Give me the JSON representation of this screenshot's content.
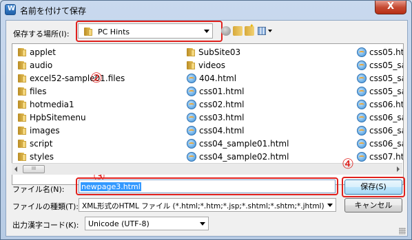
{
  "window": {
    "title": "名前を付けて保存",
    "close_label": "X"
  },
  "location": {
    "label": "保存する場所(I):",
    "value": "PC Hints"
  },
  "files": {
    "col1": [
      "applet",
      "audio",
      "excel52-sample01.files",
      "files",
      "hotmedia1",
      "HpbSitemenu",
      "images",
      "script",
      "styles"
    ],
    "col2": [
      {
        "name": "SubSite03",
        "type": "folder"
      },
      {
        "name": "videos",
        "type": "folder"
      },
      {
        "name": "404.html",
        "type": "html"
      },
      {
        "name": "css01.html",
        "type": "html"
      },
      {
        "name": "css02.html",
        "type": "html"
      },
      {
        "name": "css03.html",
        "type": "html"
      },
      {
        "name": "css04.html",
        "type": "html"
      },
      {
        "name": "css04_sample01.html",
        "type": "html"
      },
      {
        "name": "css04_sample02.html",
        "type": "html"
      }
    ],
    "col3": [
      "css05.ht",
      "css05_sa",
      "css05_sa",
      "css05_sa",
      "css06.ht",
      "css06_sa",
      "css06_sa",
      "css06_sa",
      "css07.ht"
    ],
    "scroll_thumb_label": "III"
  },
  "filename": {
    "label": "ファイル名(N):",
    "value": "newpage3.html"
  },
  "filetype": {
    "label": "ファイルの種類(T):",
    "value": "XML形式のHTML ファイル (*.html;*.htm;*.jsp;*.shtml;*.shtm;*.jhtml)"
  },
  "encoding": {
    "label": "出力漢字コード(K):",
    "value": "Unicode (UTF-8)"
  },
  "buttons": {
    "save": "保存(S)",
    "cancel": "キャンセル"
  },
  "markers": {
    "m2": "②",
    "m3": "③",
    "m4": "④"
  },
  "colors": {
    "highlight": "#e0201c",
    "selection": "#3399ff"
  }
}
